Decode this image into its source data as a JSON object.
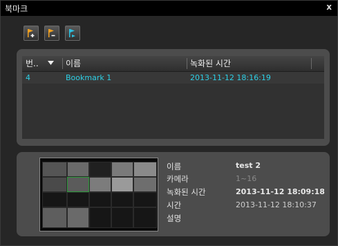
{
  "window": {
    "title": "북마크",
    "close": "x"
  },
  "toolbar": {
    "buttons": [
      {
        "icon": "flag-add-icon",
        "color": "#f0a020"
      },
      {
        "icon": "flag-remove-icon",
        "color": "#f0a020"
      },
      {
        "icon": "flag-goto-icon",
        "color": "#2dc0e0"
      }
    ]
  },
  "list": {
    "columns": [
      "번..",
      "이름",
      "녹화된 시간"
    ],
    "rows": [
      {
        "number": "4",
        "name": "Bookmark 1",
        "time": "2013-11-12 18:16:19"
      }
    ],
    "accent": "#2dd0e6"
  },
  "detail": {
    "labels": {
      "name": "이름",
      "camera": "카메라",
      "recorded": "녹화된 시간",
      "time": "시간",
      "description": "설명"
    },
    "values": {
      "name": "test 2",
      "camera": "1~16",
      "recorded": "2013-11-12 18:09:18",
      "time": "2013-11-12 18:10:37",
      "description": ""
    }
  }
}
